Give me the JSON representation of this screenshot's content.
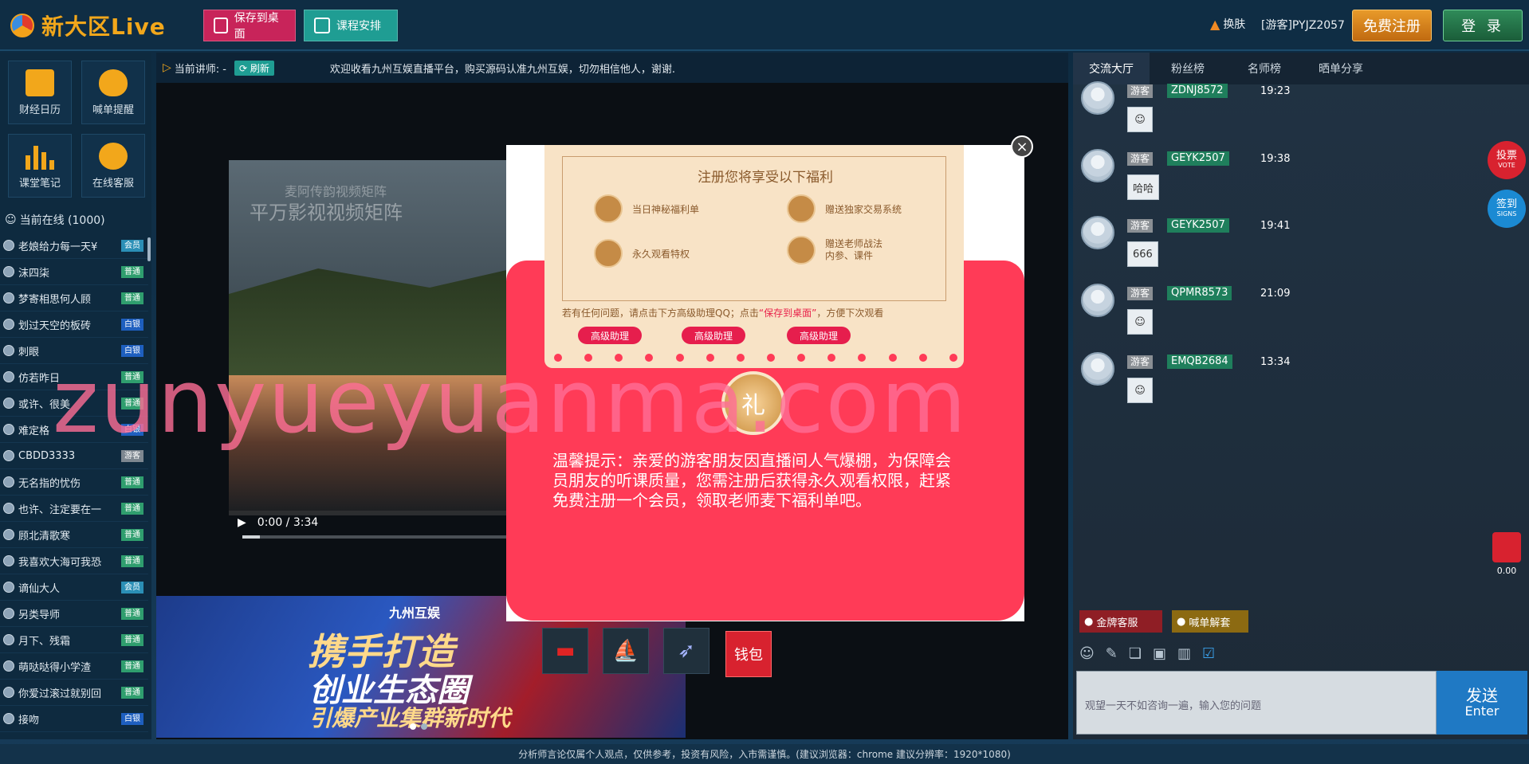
{
  "header": {
    "logo_text": "新大区Live",
    "save_label": "保存到桌面",
    "course_label": "课程安排",
    "theme_label": "换肤",
    "guest_label": "[游客]PYJZ2057",
    "register_label": "免费注册",
    "login_label": "登 录"
  },
  "tools": [
    "财经日历",
    "喊单提醒",
    "课堂笔记",
    "在线客服"
  ],
  "online": {
    "title": "当前在线 (1000)"
  },
  "users": [
    {
      "name": "老娘给力每一天¥",
      "badge": "会员",
      "kind": "b-cyan"
    },
    {
      "name": "沫四柒",
      "badge": "普通",
      "kind": "b-green"
    },
    {
      "name": "梦寄相思何人顾",
      "badge": "普通",
      "kind": "b-green"
    },
    {
      "name": "划过天空的板砖",
      "badge": "白银",
      "kind": "b-blue"
    },
    {
      "name": "刺眼",
      "badge": "白银",
      "kind": "b-blue"
    },
    {
      "name": "仿若昨日",
      "badge": "普通",
      "kind": "b-green"
    },
    {
      "name": "或许、很美",
      "badge": "普通",
      "kind": "b-green"
    },
    {
      "name": "难定格",
      "badge": "白银",
      "kind": "b-blue"
    },
    {
      "name": "CBDD3333",
      "badge": "游客",
      "kind": "b-gray"
    },
    {
      "name": "无名指的忧伤",
      "badge": "普通",
      "kind": "b-green"
    },
    {
      "name": "也许、注定要在一",
      "badge": "普通",
      "kind": "b-green"
    },
    {
      "name": "顾北清歌寒",
      "badge": "普通",
      "kind": "b-green"
    },
    {
      "name": "我喜欢大海可我恐",
      "badge": "普通",
      "kind": "b-green"
    },
    {
      "name": "谪仙大人",
      "badge": "会员",
      "kind": "b-cyan"
    },
    {
      "name": "另类导师",
      "badge": "普通",
      "kind": "b-green"
    },
    {
      "name": "月下、残霜",
      "badge": "普通",
      "kind": "b-green"
    },
    {
      "name": "萌哒哒得小学渣",
      "badge": "普通",
      "kind": "b-green"
    },
    {
      "name": "你爱过滚过就别回",
      "badge": "普通",
      "kind": "b-green"
    },
    {
      "name": "接吻",
      "badge": "白银",
      "kind": "b-blue"
    }
  ],
  "noticebar": {
    "lecturer_label": "当前讲师: -",
    "refresh_label": "刷新",
    "notice": "欢迎收看九州互娱直播平台，购买源码认准九州互娱，切勿相信他人，谢谢."
  },
  "video": {
    "watermark_small": "麦阿传韵视频矩阵",
    "watermark_big": "平万影视视频矩阵",
    "time": "0:00 / 3:34",
    "progress": 0.04
  },
  "banner": {
    "logo": "九州互娱",
    "line1": "携手打造",
    "line2": "创业生态圈",
    "line3": "引爆产业集群新时代"
  },
  "gifts": {
    "wallet_label": "钱包"
  },
  "chat": {
    "tabs": [
      "交流大厅",
      "粉丝榜",
      "名师榜",
      "晒单分享"
    ],
    "messages": [
      {
        "tag": "游客",
        "nick": "ZDNJ8572",
        "time": "19:23",
        "content": ""
      },
      {
        "tag": "游客",
        "nick": "GEYK2507",
        "time": "19:38",
        "content": "哈哈"
      },
      {
        "tag": "游客",
        "nick": "GEYK2507",
        "time": "19:41",
        "content": "666"
      },
      {
        "tag": "游客",
        "nick": "QPMR8573",
        "time": "21:09",
        "content": ""
      },
      {
        "tag": "游客",
        "nick": "EMQB2684",
        "time": "13:34",
        "content": ""
      }
    ],
    "service_label": "金牌客服",
    "analysis_label": "喊单解套",
    "input_placeholder": "观望一天不如咨询一遍，输入您的问题",
    "send_label": "发送",
    "send_sub": "Enter"
  },
  "side": {
    "vote": "投票",
    "vote_sub": "VOTE",
    "sign": "签到",
    "sign_sub": "SIGNS",
    "red_amount": "0.00"
  },
  "footer": {
    "text": "分析师言论仅属个人观点，仅供参考，投资有风险，入市需谨慎。(建议浏览器：chrome 建议分辨率：1920*1080)"
  },
  "modal": {
    "title": "注册您将享受以下福利",
    "benefits": [
      "当日神秘福利单",
      "赠送独家交易系统",
      "永久观看特权",
      "赠送老师战法\n内参、课件"
    ],
    "help_pre": "若有任何问题，请点击下方高级助理QQ；点击",
    "help_link": "“保存到桌面”",
    "help_post": "，方便下次观看",
    "assist_label": "高级助理",
    "seal": "礼",
    "tip": "温馨提示：亲爱的游客朋友因直播间人气爆棚，为保障会员朋友的听课质量，您需注册后获得永久观看权限，赶紧免费注册一个会员，领取老师麦下福利单吧。",
    "close": "×"
  },
  "watermark": "zunyueyuanma.com"
}
